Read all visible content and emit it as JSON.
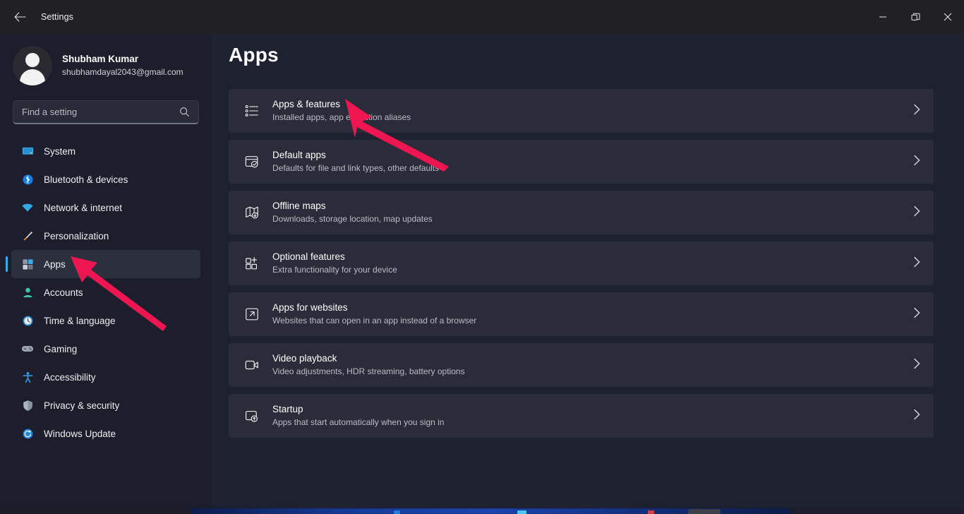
{
  "window": {
    "title": "Settings",
    "back_icon": "back-arrow-icon",
    "minimize_label": "—",
    "maximize_label": "❐",
    "close_label": "✕"
  },
  "sidebar": {
    "user": {
      "name": "Shubham Kumar",
      "email": "shubhamdayal2043@gmail.com",
      "avatar_icon": "user-avatar-icon"
    },
    "search": {
      "placeholder": "Find a setting",
      "value": "",
      "icon": "search-icon"
    },
    "items": [
      {
        "label": "System",
        "icon": "monitor-icon",
        "active": false
      },
      {
        "label": "Bluetooth & devices",
        "icon": "bluetooth-icon",
        "active": false
      },
      {
        "label": "Network & internet",
        "icon": "wifi-icon",
        "active": false
      },
      {
        "label": "Personalization",
        "icon": "paintbrush-icon",
        "active": false
      },
      {
        "label": "Apps",
        "icon": "apps-grid-icon",
        "active": true
      },
      {
        "label": "Accounts",
        "icon": "person-icon",
        "active": false
      },
      {
        "label": "Time & language",
        "icon": "clock-icon",
        "active": false
      },
      {
        "label": "Gaming",
        "icon": "gamepad-icon",
        "active": false
      },
      {
        "label": "Accessibility",
        "icon": "accessibility-icon",
        "active": false
      },
      {
        "label": "Privacy & security",
        "icon": "shield-icon",
        "active": false
      },
      {
        "label": "Windows Update",
        "icon": "update-icon",
        "active": false
      }
    ]
  },
  "main": {
    "page_title": "Apps",
    "cards": [
      {
        "title": "Apps & features",
        "subtitle": "Installed apps, app execution aliases",
        "icon": "list-bullets-icon",
        "chevron": "›"
      },
      {
        "title": "Default apps",
        "subtitle": "Defaults for file and link types, other defaults",
        "icon": "default-app-check-icon",
        "chevron": "›"
      },
      {
        "title": "Offline maps",
        "subtitle": "Downloads, storage location, map updates",
        "icon": "map-download-icon",
        "chevron": "›"
      },
      {
        "title": "Optional features",
        "subtitle": "Extra functionality for your device",
        "icon": "add-square-icon",
        "chevron": "›"
      },
      {
        "title": "Apps for websites",
        "subtitle": "Websites that can open in an app instead of a browser",
        "icon": "external-link-icon",
        "chevron": "›"
      },
      {
        "title": "Video playback",
        "subtitle": "Video adjustments, HDR streaming, battery options",
        "icon": "video-camera-icon",
        "chevron": "›"
      },
      {
        "title": "Startup",
        "subtitle": "Apps that start automatically when you sign in",
        "icon": "startup-upload-icon",
        "chevron": "›"
      }
    ]
  },
  "annotations": {
    "color": "#ED1651",
    "arrows": [
      {
        "name": "arrow-to-apps-and-features"
      },
      {
        "name": "arrow-to-apps-sidebar"
      }
    ]
  },
  "colors": {
    "titlebar_bg": "#202025",
    "sidebar_bg": "#1c1f2b",
    "content_bg": "#1e2130",
    "card_bg": "#2a2d39",
    "accent": "#3fa7f0",
    "annotation": "#ED1651"
  }
}
